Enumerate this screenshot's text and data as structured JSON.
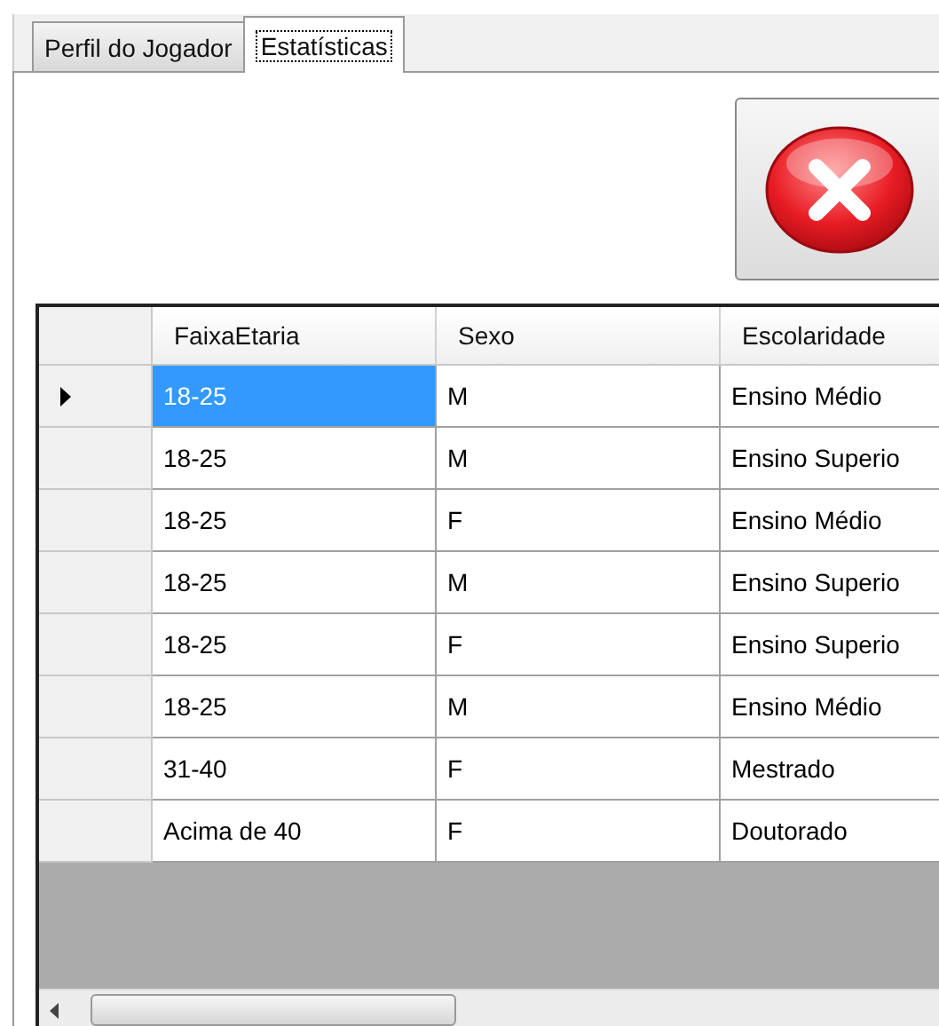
{
  "tabs": [
    {
      "label": "Perfil do Jogador",
      "selected": false
    },
    {
      "label": "Estatísticas",
      "selected": true
    }
  ],
  "table": {
    "columns": [
      "FaixaEtaria",
      "Sexo",
      "Escolaridade"
    ],
    "rows": [
      {
        "current": true,
        "cells": [
          {
            "text": "18-25",
            "selected": true
          },
          {
            "text": "M",
            "selected": false
          },
          {
            "text": "Ensino Médio",
            "selected": false
          }
        ]
      },
      {
        "current": false,
        "cells": [
          {
            "text": "18-25",
            "selected": false
          },
          {
            "text": "M",
            "selected": false
          },
          {
            "text": "Ensino Superio",
            "selected": false
          }
        ]
      },
      {
        "current": false,
        "cells": [
          {
            "text": "18-25",
            "selected": false
          },
          {
            "text": "F",
            "selected": false
          },
          {
            "text": "Ensino Médio",
            "selected": false
          }
        ]
      },
      {
        "current": false,
        "cells": [
          {
            "text": "18-25",
            "selected": false
          },
          {
            "text": "M",
            "selected": false
          },
          {
            "text": "Ensino Superio",
            "selected": false
          }
        ]
      },
      {
        "current": false,
        "cells": [
          {
            "text": "18-25",
            "selected": false
          },
          {
            "text": "F",
            "selected": false
          },
          {
            "text": "Ensino Superio",
            "selected": false
          }
        ]
      },
      {
        "current": false,
        "cells": [
          {
            "text": "18-25",
            "selected": false
          },
          {
            "text": "M",
            "selected": false
          },
          {
            "text": "Ensino Médio",
            "selected": false
          }
        ]
      },
      {
        "current": false,
        "cells": [
          {
            "text": "31-40",
            "selected": false
          },
          {
            "text": "F",
            "selected": false
          },
          {
            "text": "Mestrado",
            "selected": false
          }
        ]
      },
      {
        "current": false,
        "cells": [
          {
            "text": "Acima de 40",
            "selected": false
          },
          {
            "text": "F",
            "selected": false
          },
          {
            "text": "Doutorado",
            "selected": false
          }
        ]
      }
    ]
  }
}
